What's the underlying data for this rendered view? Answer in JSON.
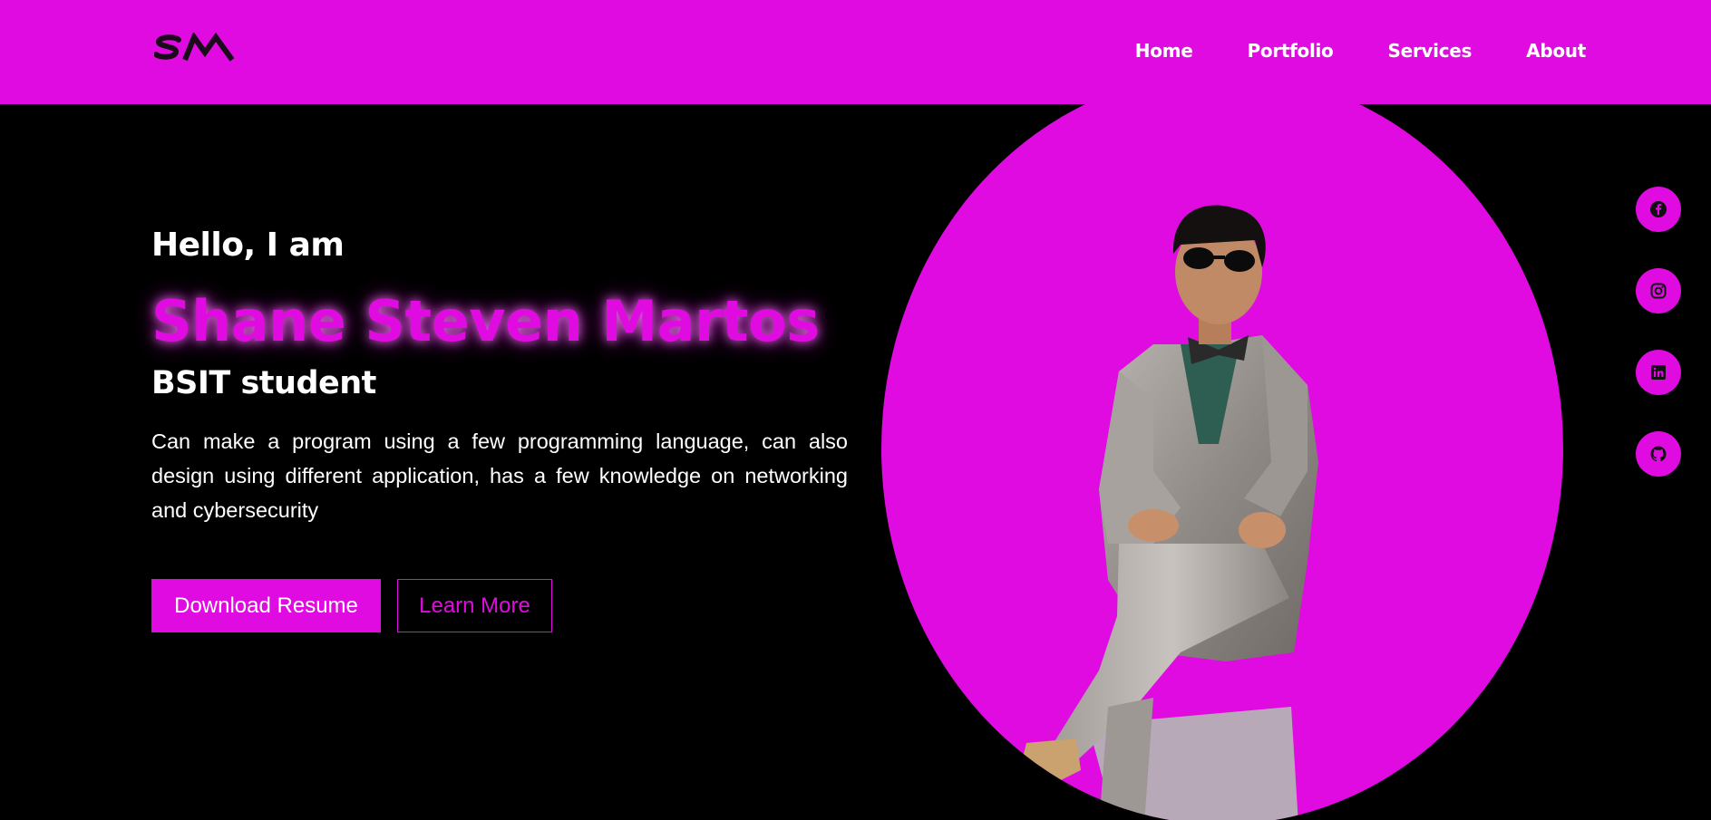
{
  "header": {
    "logo_text": "SM",
    "nav": [
      {
        "label": "Home"
      },
      {
        "label": "Portfolio"
      },
      {
        "label": "Services"
      },
      {
        "label": "About"
      }
    ]
  },
  "hero": {
    "greeting": "Hello, I am",
    "name": "Shane Steven Martos",
    "role": "BSIT student",
    "description": "Can make a program using a few programming language, can also design using different application, has a few knowledge on networking and cybersecurity",
    "buttons": {
      "primary": "Download Resume",
      "secondary": "Learn More"
    },
    "photo": "person-in-silver-suit"
  },
  "socials": [
    {
      "icon": "facebook-icon"
    },
    {
      "icon": "instagram-icon"
    },
    {
      "icon": "linkedin-icon"
    },
    {
      "icon": "github-icon"
    }
  ],
  "colors": {
    "accent": "#e00be1",
    "background": "#000000",
    "text": "#ffffff"
  }
}
